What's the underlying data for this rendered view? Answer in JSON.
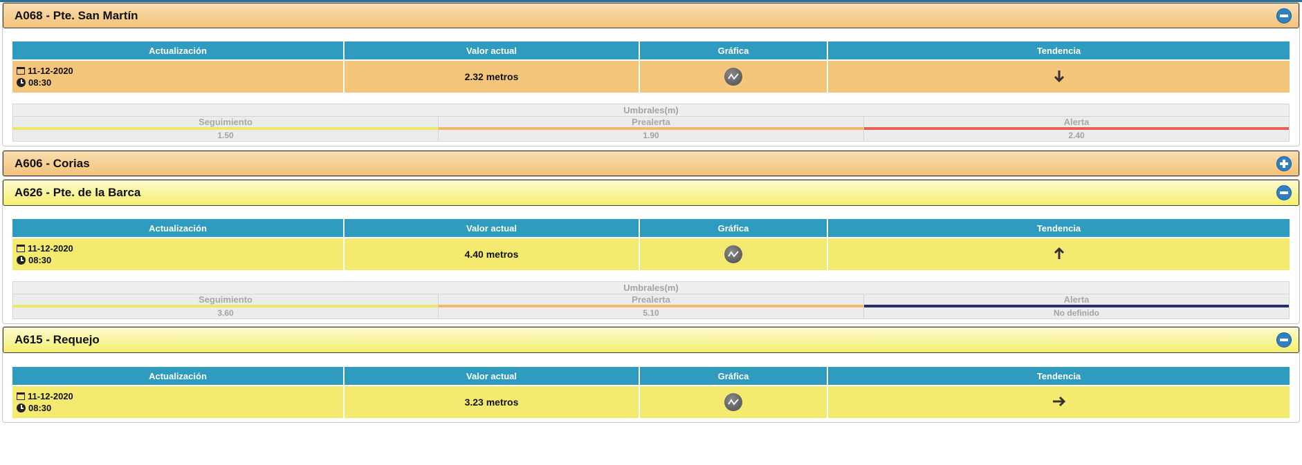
{
  "headers": {
    "actualizacion": "Actualización",
    "valor": "Valor actual",
    "grafica": "Gráfica",
    "tendencia": "Tendencia"
  },
  "thresholds_caption": "Umbrales(m)",
  "threshold_names": {
    "seguimiento": "Seguimiento",
    "prealerta": "Prealerta",
    "alerta": "Alerta"
  },
  "colors": {
    "seguimiento_bar": "#eee86a",
    "prealerta_bar": "#f2b86a",
    "alerta_bar": "#e8605a",
    "alerta_undefined_bar": "#23306e",
    "header_bg": "#2e9bbf"
  },
  "stations": [
    {
      "title": "A068 - Pte. San Martín",
      "expanded": true,
      "toggle_icon": "minus-circle-icon",
      "date": "11-12-2020",
      "time": "08:30",
      "value": "2.32 metros",
      "trend_icon": "arrow-down-icon",
      "trend_glyph": "🡓",
      "thresholds": {
        "seguimiento": "1.50",
        "prealerta": "1.90",
        "alerta": "2.40"
      }
    },
    {
      "title": "A606 - Corias",
      "expanded": false,
      "toggle_icon": "plus-circle-icon"
    },
    {
      "title": "A626 - Pte. de la Barca",
      "expanded": true,
      "toggle_icon": "minus-circle-icon",
      "date": "11-12-2020",
      "time": "08:30",
      "value": "4.40 metros",
      "trend_icon": "arrow-up-icon",
      "trend_glyph": "🡑",
      "thresholds": {
        "seguimiento": "3.60",
        "prealerta": "5.10",
        "alerta": "No definido"
      }
    },
    {
      "title": "A615 - Requejo",
      "expanded": true,
      "toggle_icon": "minus-circle-icon",
      "date": "11-12-2020",
      "time": "08:30",
      "value": "3.23 metros",
      "trend_icon": "arrow-right-icon",
      "trend_glyph": "🡒"
    }
  ]
}
